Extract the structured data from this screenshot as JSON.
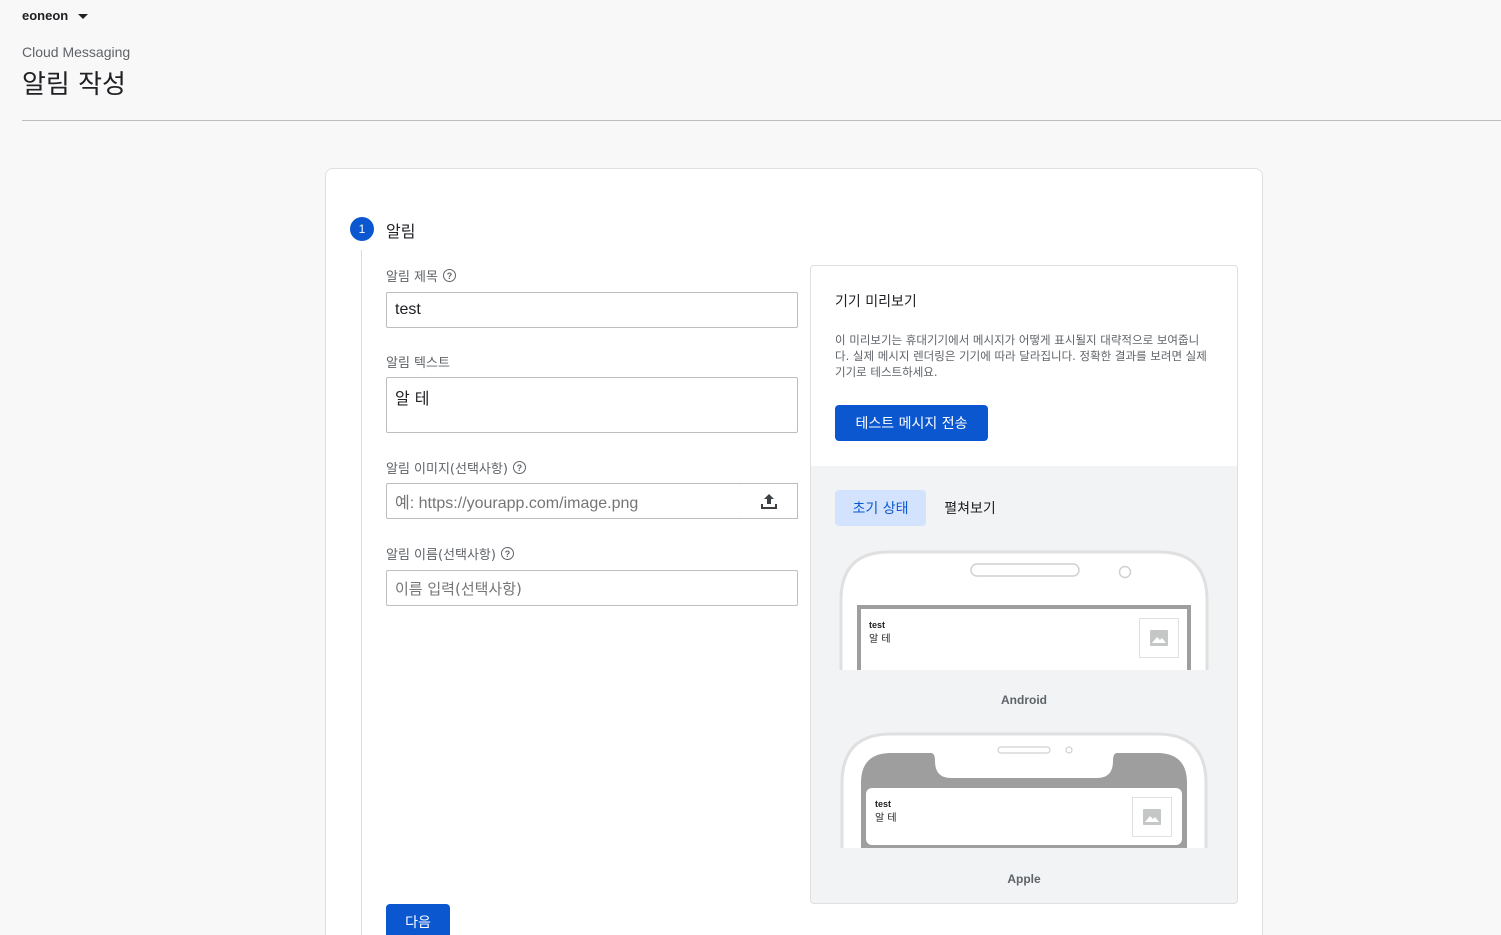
{
  "header": {
    "project": "eoneon",
    "product": "Cloud Messaging",
    "title": "알림 작성"
  },
  "step": {
    "number": "1",
    "title": "알림"
  },
  "form": {
    "title_label": "알림 제목",
    "title_value": "test",
    "text_label": "알림 텍스트",
    "text_value": "알 테",
    "image_label": "알림 이미지(선택사항)",
    "image_placeholder": "예: https://yourapp.com/image.png",
    "name_label": "알림 이름(선택사항)",
    "name_placeholder": "이름 입력(선택사항)",
    "next_label": "다음"
  },
  "preview": {
    "title": "기기 미리보기",
    "description": "이 미리보기는 휴대기기에서 메시지가 어떻게 표시될지 대략적으로 보여줍니다. 실제 메시지 렌더링은 기기에 따라 달라집니다. 정확한 결과를 보려면 실제 기기로 테스트하세요.",
    "test_button": "테스트 메시지 전송",
    "tabs": [
      "초기 상태",
      "펼쳐보기"
    ],
    "android": {
      "label": "Android",
      "notif_title": "test",
      "notif_body": "알 테"
    },
    "apple": {
      "label": "Apple",
      "notif_title": "test",
      "notif_body": "알 테"
    }
  }
}
